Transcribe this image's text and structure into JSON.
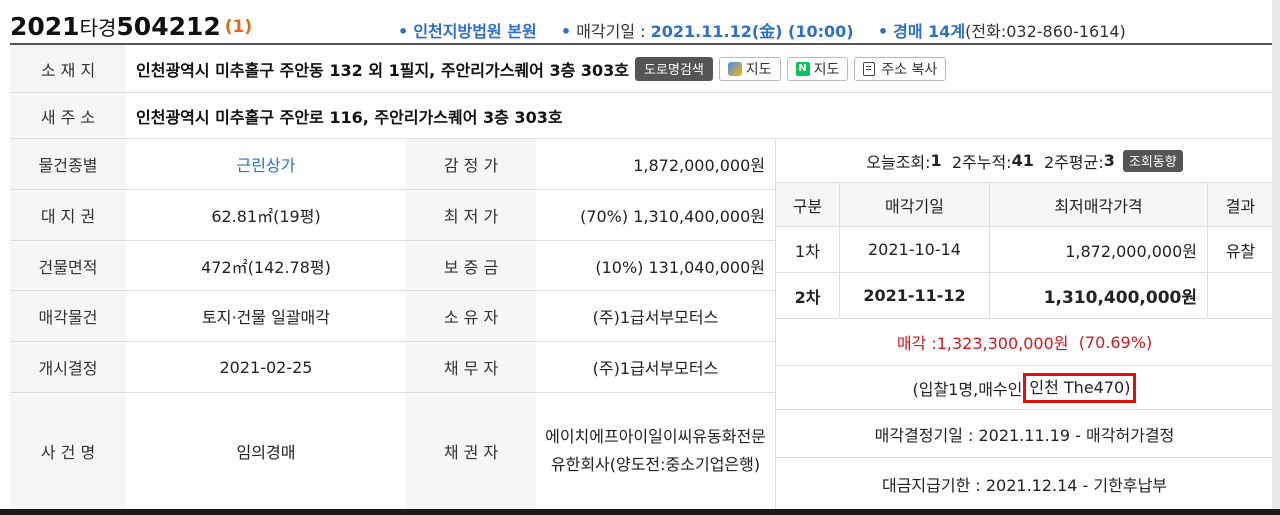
{
  "header": {
    "case_year": "2021",
    "case_kind": "타경",
    "case_number": "504212",
    "case_count": "(1)",
    "court_bullet": "•",
    "court": "인천지방법원 본원",
    "date_label": "매각기일 : ",
    "date_value": "2021.11.12(金) (10:00)",
    "dept": "경매 14계",
    "phone": "(전화:032-860-1614)"
  },
  "rows": {
    "location_label": "소 재 지",
    "location_value": "인천광역시 미추홀구 주안동 132 외 1필지, 주안리가스퀘어 3층 303호",
    "road_search_btn": "도로명검색",
    "daum_map_btn": "지도",
    "naver_map_btn": "지도",
    "copy_addr_btn": "주소 복사",
    "new_addr_label": "새 주 소",
    "new_addr_value": "인천광역시 미추홀구 주안로 116, 주안리가스퀘어 3층 303호",
    "type_label": "물건종별",
    "type_value": "근린상가",
    "appraisal_label": "감 정 가",
    "appraisal_value": "1,872,000,000원",
    "land_label": "대 지 권",
    "land_value": "62.81㎡(19평)",
    "min_price_label": "최 저 가",
    "min_price_value": "(70%) 1,310,400,000원",
    "bldg_label": "건물면적",
    "bldg_value": "472㎡(142.78평)",
    "deposit_label": "보 증 금",
    "deposit_value": "(10%) 131,040,000원",
    "sale_item_label": "매각물건",
    "sale_item_value": "토지·건물 일괄매각",
    "owner_label": "소 유 자",
    "owner_value": "(주)1급서부모터스",
    "start_label": "개시결정",
    "start_value": "2021-02-25",
    "debtor_label": "채 무 자",
    "debtor_value": "(주)1급서부모터스",
    "case_name_label": "사 건 명",
    "case_name_value": "임의경매",
    "creditor_label": "채 권 자",
    "creditor_value": "에이치에프아이일이씨유동화전문 유한회사(양도전:중소기업은행)"
  },
  "stats": {
    "today_label": "오늘조회: ",
    "today_value": "1",
    "two_week_total_label": "2주누적: ",
    "two_week_total_value": "41",
    "two_week_avg_label": "2주평균: ",
    "two_week_avg_value": "3",
    "trend_btn": "조회동향"
  },
  "history": {
    "headers": [
      "구분",
      "매각기일",
      "최저매각가격",
      "결과"
    ],
    "rows": [
      {
        "round": "1차",
        "date": "2021-10-14",
        "price": "1,872,000,000원",
        "result": "유찰"
      },
      {
        "round": "2차",
        "date": "2021-11-12",
        "price": "1,310,400,000원",
        "result": ""
      }
    ]
  },
  "result": {
    "sold_label": "매각 : ",
    "sold_price": "1,323,300,000원",
    "sold_ratio": "(70.69%)",
    "bidders": "(입찰1명,매수인",
    "buyer": "인천 The470)",
    "decision": "매각결정기일 : 2021.11.19 - 매각허가결정",
    "payment": "대금지급기한 : 2021.12.14 - 기한후납부"
  },
  "colors": {
    "accent_blue": "#2d6fc9",
    "count_orange": "#e06a17",
    "sold_red": "#d4171f",
    "highlight_box": "#e01010"
  }
}
